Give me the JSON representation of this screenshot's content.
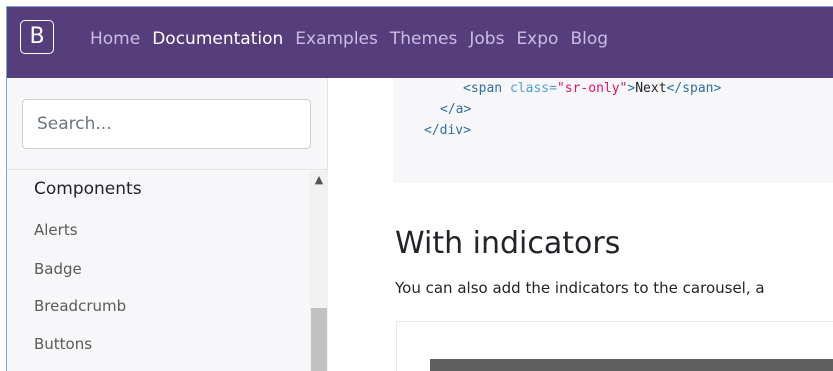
{
  "navbar": {
    "brand": "B",
    "links": [
      {
        "label": "Home",
        "active": false
      },
      {
        "label": "Documentation",
        "active": true
      },
      {
        "label": "Examples",
        "active": false
      },
      {
        "label": "Themes",
        "active": false
      },
      {
        "label": "Jobs",
        "active": false
      },
      {
        "label": "Expo",
        "active": false
      },
      {
        "label": "Blog",
        "active": false
      }
    ]
  },
  "sidebar": {
    "search_placeholder": "Search...",
    "section": "Components",
    "items": [
      "Alerts",
      "Badge",
      "Breadcrumb",
      "Buttons"
    ]
  },
  "main": {
    "code": {
      "line1": {
        "open": "<span ",
        "attr": "class=",
        "value": "\"sr-only\"",
        "close": ">",
        "text": "Next",
        "end": "</span>"
      },
      "line2": "</a>",
      "line3": "</div>"
    },
    "heading": "With indicators",
    "paragraph": "You can also add the indicators to the carousel, a"
  },
  "colors": {
    "navbar_bg": "#563d7c",
    "nav_link": "#cbbde2",
    "code_string": "#e0116f",
    "code_tag": "#2f6f9f"
  }
}
